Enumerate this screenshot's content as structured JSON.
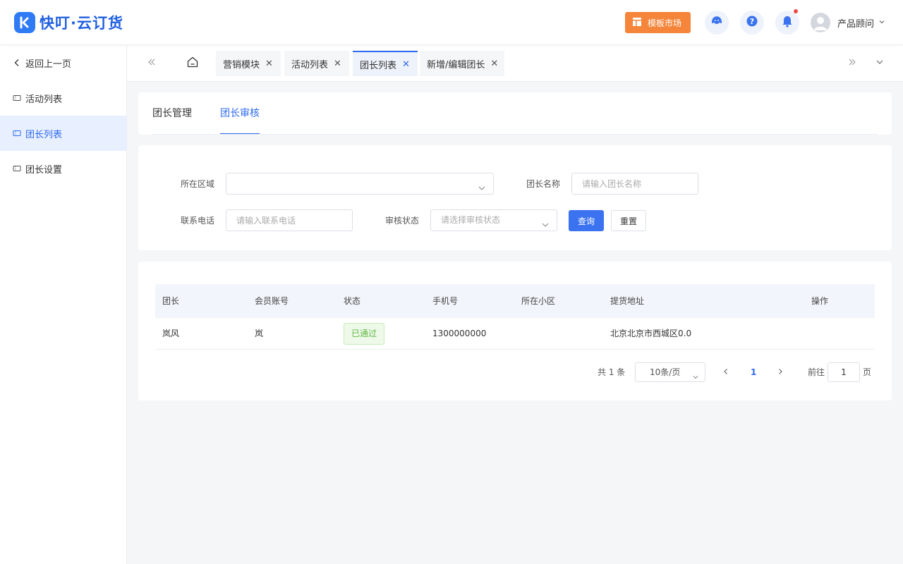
{
  "app": {
    "logo_text": "快叮·云订货",
    "brand_color": "#2f6bf0"
  },
  "header": {
    "market_button": "模板市场",
    "user_name": "产品顾问",
    "icons": [
      "support-icon",
      "help-icon",
      "bell-icon"
    ]
  },
  "sidebar": {
    "back": "返回上一页",
    "items": [
      {
        "label": "活动列表",
        "active": false
      },
      {
        "label": "团长列表",
        "active": true
      },
      {
        "label": "团长设置",
        "active": false
      }
    ]
  },
  "tabs": [
    {
      "label": "营销模块",
      "active": false
    },
    {
      "label": "活动列表",
      "active": false
    },
    {
      "label": "团长列表",
      "active": true
    },
    {
      "label": "新增/编辑团长",
      "active": false
    }
  ],
  "subtabs": [
    {
      "label": "团长管理",
      "active": false
    },
    {
      "label": "团长审核",
      "active": true
    }
  ],
  "filters": {
    "region_label": "所在区域",
    "region_value": "",
    "name_label": "团长名称",
    "name_placeholder": "请输入团长名称",
    "phone_label": "联系电话",
    "phone_placeholder": "请输入联系电话",
    "status_label": "审核状态",
    "status_placeholder": "请选择审核状态",
    "query_button": "查询",
    "reset_button": "重置"
  },
  "table": {
    "columns": [
      "团长",
      "会员账号",
      "状态",
      "手机号",
      "所在小区",
      "提货地址",
      "操作"
    ],
    "rows": [
      {
        "leader": "岚风",
        "account": "岚",
        "status": "已通过",
        "phone": "1300000000",
        "community": "",
        "address": "北京北京市西城区0.0",
        "action": ""
      }
    ]
  },
  "pagination": {
    "total_text": "共 1 条",
    "page_size": "10条/页",
    "current_page": "1",
    "goto_label": "前往",
    "goto_value": "1",
    "page_unit": "页"
  }
}
